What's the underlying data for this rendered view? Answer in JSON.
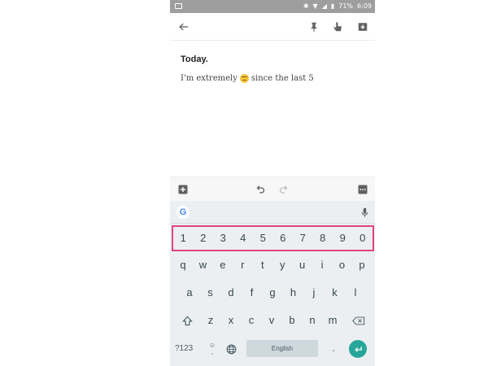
{
  "status_bar": {
    "battery_text": "71%",
    "time": "6:09",
    "icons": [
      "image-icon",
      "bluetooth-icon",
      "wifi-icon",
      "signal-icon",
      "battery-icon"
    ]
  },
  "toolbar": {
    "icons": [
      "back-arrow-icon",
      "pin-icon",
      "reminder-hand-icon",
      "archive-icon"
    ]
  },
  "note": {
    "title": "Today.",
    "body_before_emoji": "I'm extremely",
    "body_after_emoji": "since the last 5"
  },
  "editor_actions": {
    "icons": [
      "add-box-icon",
      "undo-icon",
      "redo-icon",
      "more-icon"
    ]
  },
  "keyboard": {
    "logo": "G",
    "number_row": [
      "1",
      "2",
      "3",
      "4",
      "5",
      "6",
      "7",
      "8",
      "9",
      "0"
    ],
    "row1": [
      "q",
      "w",
      "e",
      "r",
      "t",
      "y",
      "u",
      "i",
      "o",
      "p"
    ],
    "row2": [
      "a",
      "s",
      "d",
      "f",
      "g",
      "h",
      "j",
      "k",
      "l"
    ],
    "row3": [
      "z",
      "x",
      "c",
      "v",
      "b",
      "n",
      "m"
    ],
    "symbols_label": "?123",
    "emoji_label": "☺",
    "emoji_comma": ",",
    "space_label": "English",
    "period_label": "."
  },
  "colors": {
    "highlight_border": "#e0457b",
    "enter_key": "#26a69a",
    "status_bar": "#9e9e9e",
    "keyboard_bg": "#eceff1"
  }
}
